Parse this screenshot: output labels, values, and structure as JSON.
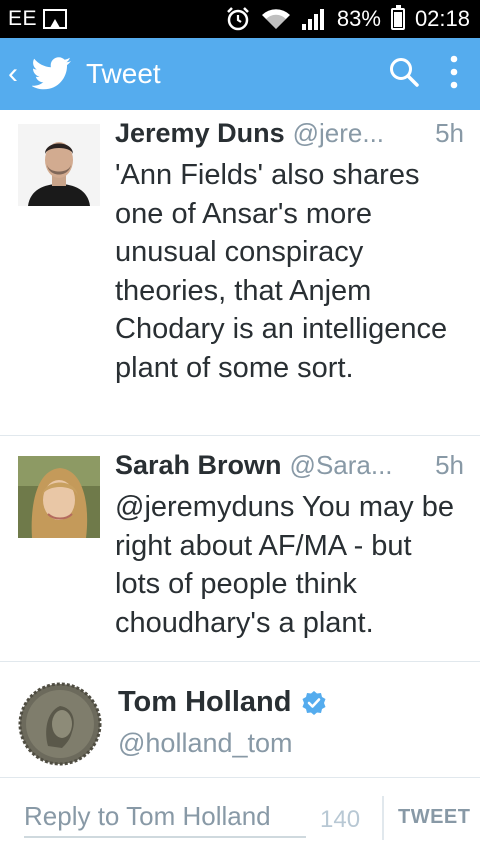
{
  "status_bar": {
    "carrier": "EE",
    "battery": "83%",
    "battery_level": 0.83,
    "time": "02:18",
    "icons": [
      "image-icon",
      "alarm-icon",
      "wifi-icon",
      "signal-icon",
      "battery-icon"
    ]
  },
  "app_bar": {
    "back": "‹",
    "title": "Tweet",
    "color": "#55acee",
    "icons": [
      "twitter-bird-icon",
      "search-icon",
      "overflow-menu-icon"
    ]
  },
  "tweets": [
    {
      "name": "Jeremy Duns",
      "handle": "@jere...",
      "time": "5h",
      "text": "'Ann Fields' also shares one of Ansar's more unusual conspiracy theories, that Anjem Chodary is an intelligence plant of some sort."
    },
    {
      "name": "Sarah Brown",
      "handle": "@Sara...",
      "time": "5h",
      "text": "@jeremyduns You may be right about AF/MA - but lots of people think choudhary's a plant."
    }
  ],
  "profile": {
    "name": "Tom Holland",
    "handle": "@holland_tom",
    "verified": true
  },
  "reply": {
    "placeholder": "Reply to Tom Holland",
    "char_count": "140",
    "button": "TWEET"
  }
}
